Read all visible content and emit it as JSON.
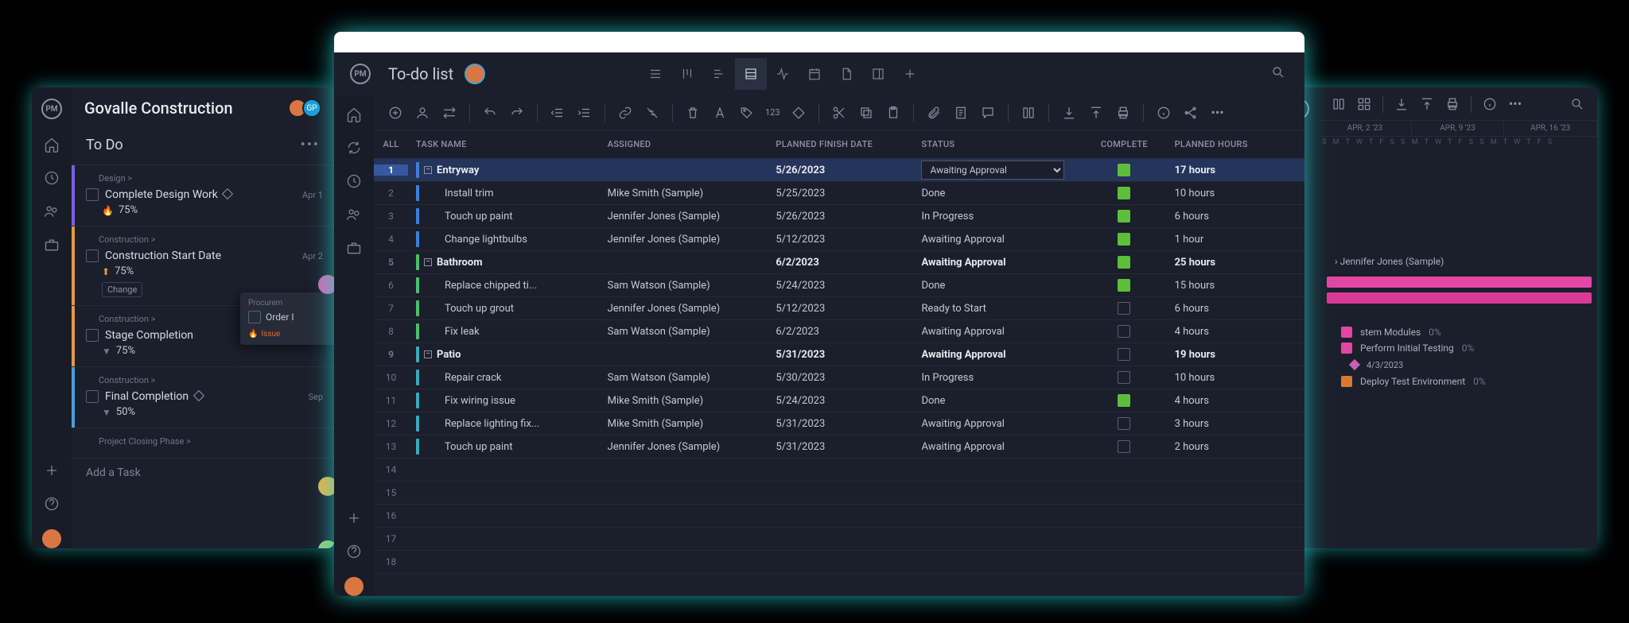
{
  "left": {
    "project_title": "Govalle Construction",
    "section_title": "To Do",
    "add_task": "Add a Task",
    "avatar_initials": "GP",
    "tasks": [
      {
        "crumb": "Design >",
        "name": "Complete Design Work",
        "diamond": true,
        "date": "Apr 1",
        "icon": "flame",
        "pct": "75%",
        "chip": null,
        "color": "c-purple"
      },
      {
        "crumb": "Construction >",
        "name": "Construction Start Date",
        "diamond": false,
        "date": "Apr 2",
        "icon": "arrow-up",
        "pct": "75%",
        "chip": "Change",
        "color": "c-orange"
      },
      {
        "crumb": "Construction >",
        "name": "Stage Completion",
        "diamond": false,
        "date": "",
        "icon": "arrow-down",
        "pct": "75%",
        "chip": null,
        "color": "c-orange2"
      },
      {
        "crumb": "Construction >",
        "name": "Final Completion",
        "diamond": true,
        "date": "Sep",
        "icon": "arrow-down",
        "pct": "50%",
        "chip": null,
        "color": "c-blue"
      },
      {
        "crumb": "Project Closing Phase >",
        "name": "",
        "diamond": false,
        "date": "",
        "icon": "",
        "pct": "",
        "chip": null,
        "color": ""
      }
    ],
    "overlay": {
      "crumb": "Procurem",
      "name": "Order I",
      "issue": "Issue"
    }
  },
  "center": {
    "title": "To-do list",
    "all_label": "ALL",
    "toolbar_num": "123",
    "columns": {
      "name": "TASK NAME",
      "assigned": "ASSIGNED",
      "date": "PLANNED FINISH DATE",
      "status": "STATUS",
      "complete": "COMPLETE",
      "hours": "PLANNED HOURS"
    },
    "status_sel": "Awaiting Approval",
    "rows": [
      {
        "n": 1,
        "parent": true,
        "bar": "blue",
        "name": "Entryway",
        "assigned": "",
        "date": "5/26/2023",
        "status": "select",
        "done": true,
        "hours": "17 hours",
        "hl": true
      },
      {
        "n": 2,
        "parent": false,
        "bar": "blue",
        "name": "Install trim",
        "assigned": "Mike Smith (Sample)",
        "date": "5/25/2023",
        "status": "Done",
        "done": true,
        "hours": "10 hours"
      },
      {
        "n": 3,
        "parent": false,
        "bar": "blue",
        "name": "Touch up paint",
        "assigned": "Jennifer Jones (Sample)",
        "date": "5/26/2023",
        "status": "In Progress",
        "done": true,
        "hours": "6 hours"
      },
      {
        "n": 4,
        "parent": false,
        "bar": "blue",
        "name": "Change lightbulbs",
        "assigned": "Jennifer Jones (Sample)",
        "date": "5/12/2023",
        "status": "Awaiting Approval",
        "done": true,
        "hours": "1 hour"
      },
      {
        "n": 5,
        "parent": true,
        "bar": "green",
        "name": "Bathroom",
        "assigned": "",
        "date": "6/2/2023",
        "status": "Awaiting Approval",
        "done": true,
        "hours": "25 hours"
      },
      {
        "n": 6,
        "parent": false,
        "bar": "green",
        "name": "Replace chipped ti...",
        "assigned": "Sam Watson (Sample)",
        "date": "5/24/2023",
        "status": "Done",
        "done": true,
        "hours": "15 hours"
      },
      {
        "n": 7,
        "parent": false,
        "bar": "green",
        "name": "Touch up grout",
        "assigned": "Jennifer Jones (Sample)",
        "date": "5/12/2023",
        "status": "Ready to Start",
        "done": false,
        "hours": "6 hours"
      },
      {
        "n": 8,
        "parent": false,
        "bar": "green",
        "name": "Fix leak",
        "assigned": "Sam Watson (Sample)",
        "date": "6/2/2023",
        "status": "Awaiting Approval",
        "done": false,
        "hours": "4 hours"
      },
      {
        "n": 9,
        "parent": true,
        "bar": "cyan",
        "name": "Patio",
        "assigned": "",
        "date": "5/31/2023",
        "status": "Awaiting Approval",
        "done": false,
        "hours": "19 hours"
      },
      {
        "n": 10,
        "parent": false,
        "bar": "cyan",
        "name": "Repair crack",
        "assigned": "Sam Watson (Sample)",
        "date": "5/30/2023",
        "status": "In Progress",
        "done": false,
        "hours": "10 hours"
      },
      {
        "n": 11,
        "parent": false,
        "bar": "cyan",
        "name": "Fix wiring issue",
        "assigned": "Mike Smith (Sample)",
        "date": "5/24/2023",
        "status": "Done",
        "done": true,
        "hours": "4 hours"
      },
      {
        "n": 12,
        "parent": false,
        "bar": "cyan",
        "name": "Replace lighting fix...",
        "assigned": "Mike Smith (Sample)",
        "date": "5/31/2023",
        "status": "Awaiting Approval",
        "done": false,
        "hours": "3 hours"
      },
      {
        "n": 13,
        "parent": false,
        "bar": "cyan",
        "name": "Touch up paint",
        "assigned": "Jennifer Jones (Sample)",
        "date": "5/31/2023",
        "status": "Awaiting Approval",
        "done": false,
        "hours": "2 hours"
      },
      {
        "n": 14,
        "parent": false,
        "bar": "",
        "name": "",
        "assigned": "",
        "date": "",
        "status": "",
        "done": null,
        "hours": ""
      },
      {
        "n": 15,
        "parent": false,
        "bar": "",
        "name": "",
        "assigned": "",
        "date": "",
        "status": "",
        "done": null,
        "hours": ""
      },
      {
        "n": 16,
        "parent": false,
        "bar": "",
        "name": "",
        "assigned": "",
        "date": "",
        "status": "",
        "done": null,
        "hours": ""
      },
      {
        "n": 17,
        "parent": false,
        "bar": "",
        "name": "",
        "assigned": "",
        "date": "",
        "status": "",
        "done": null,
        "hours": ""
      },
      {
        "n": 18,
        "parent": false,
        "bar": "",
        "name": "",
        "assigned": "",
        "date": "",
        "status": "",
        "done": null,
        "hours": ""
      }
    ]
  },
  "right": {
    "months": [
      "APR, 2 '23",
      "APR, 9 '23",
      "APR, 16 '23"
    ],
    "days": "S M T W T F S S M T W T F S S M T W T F S",
    "assignee": "Jennifer Jones (Sample)",
    "items": [
      {
        "sw": "#e246a6",
        "label": "stem Modules",
        "pct": "0%"
      },
      {
        "sw": "#e246a6",
        "label": "Perform Initial Testing",
        "pct": "0%"
      },
      {
        "sw": "",
        "label": "4/3/2023",
        "pct": "",
        "diamond": true
      },
      {
        "sw": "#d97a2e",
        "label": "Deploy Test Environment",
        "pct": "0%"
      }
    ]
  }
}
